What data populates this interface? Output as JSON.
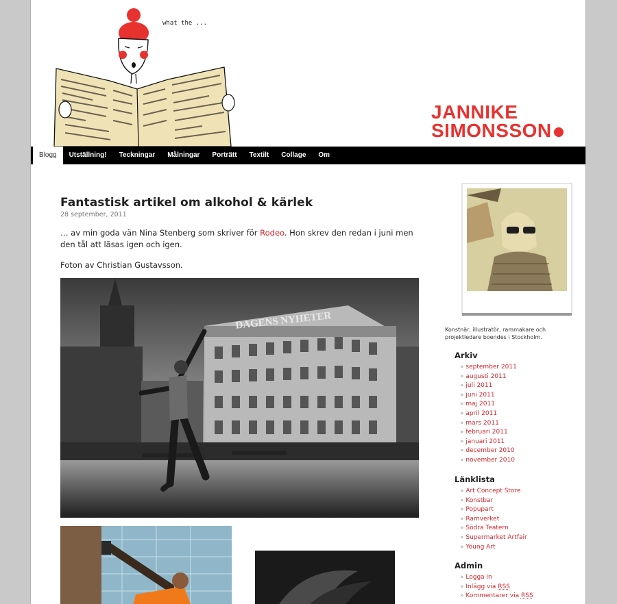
{
  "header": {
    "speech_text": "what the ...",
    "site_title_line1": "JANNIKE",
    "site_title_line2": "SIMONSSON"
  },
  "nav": {
    "items": [
      {
        "label": "Blogg",
        "active": true
      },
      {
        "label": "Utställning!"
      },
      {
        "label": "Teckningar"
      },
      {
        "label": "Målningar"
      },
      {
        "label": "Porträtt"
      },
      {
        "label": "Textilt"
      },
      {
        "label": "Collage"
      },
      {
        "label": "Om"
      }
    ]
  },
  "post": {
    "title": "Fantastisk artikel om alkohol & kärlek",
    "date": "28 september, 2011",
    "p1_before": "… av min goda vän Nina Stenberg som skriver för ",
    "p1_link": "Rodeo",
    "p1_after": ". Hon skrev den redan i juni men den tål att läsas igen och igen.",
    "p2": "Foton av Christian Gustavsson.",
    "photo_sign": "DAGENS NYHETER"
  },
  "sidebar": {
    "bio": "Konstnär, illustratör, rammakare och projektledare boendes i Stockholm.",
    "arkiv_heading": "Arkiv",
    "arkiv": [
      "september 2011",
      "augusti 2011",
      "juli 2011",
      "juni 2011",
      "maj 2011",
      "april 2011",
      "mars 2011",
      "februari 2011",
      "januari 2011",
      "december 2010",
      "november 2010"
    ],
    "links_heading": "Länklista",
    "links": [
      "Art Concept Store",
      "Konstbar",
      "Popupart",
      "Ramverket",
      "Södra Teatern",
      "Supermarket Artfair",
      "Young Art"
    ],
    "admin_heading": "Admin",
    "admin_login": "Logga in",
    "admin_rss_posts": "Inlägg via",
    "admin_rss_comments": "Kommentarer via",
    "rss": "RSS"
  },
  "colors": {
    "accent": "#e8322f",
    "link": "#d2262c",
    "nav_bg": "#000000"
  }
}
